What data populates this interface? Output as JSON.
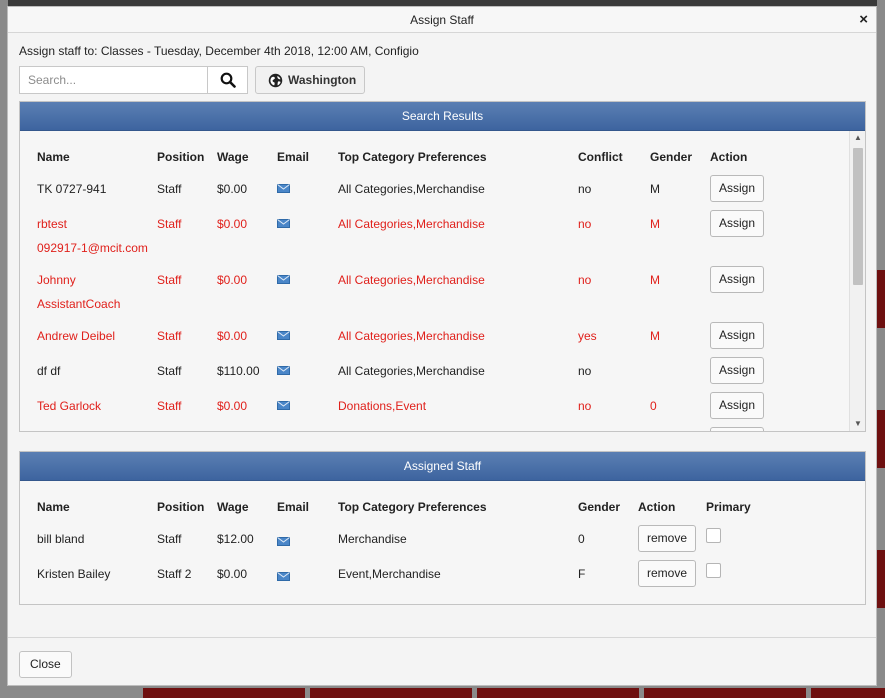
{
  "dialog": {
    "title": "Assign Staff",
    "close_symbol": "×",
    "assign_to": "Assign staff to: Classes - Tuesday, December 4th 2018, 12:00 AM, Configio"
  },
  "search": {
    "placeholder": "Search...",
    "location_label": "Washington"
  },
  "search_results": {
    "title": "Search Results",
    "headers": [
      "Name",
      "Position",
      "Wage",
      "Email",
      "Top Category Preferences",
      "Conflict",
      "Gender",
      "Action"
    ],
    "rows": [
      {
        "name": "TK 0727-941",
        "position": "Staff",
        "wage": "$0.00",
        "prefs": "All Categories,Merchandise",
        "conflict": "no",
        "gender": "M",
        "action": "Assign",
        "highlight": false
      },
      {
        "name": "rbtest",
        "position": "Staff",
        "wage": "$0.00",
        "prefs": "All Categories,Merchandise",
        "conflict": "no",
        "gender": "M",
        "action": "Assign",
        "highlight": true,
        "sub": "092917-1@mcit.com"
      },
      {
        "name": "Johnny",
        "position": "Staff",
        "wage": "$0.00",
        "prefs": "All Categories,Merchandise",
        "conflict": "no",
        "gender": "M",
        "action": "Assign",
        "highlight": true,
        "sub": "AssistantCoach"
      },
      {
        "name": "Andrew Deibel",
        "position": "Staff",
        "wage": "$0.00",
        "prefs": "All Categories,Merchandise",
        "conflict": "yes",
        "gender": "M",
        "action": "Assign",
        "highlight": true
      },
      {
        "name": "df df",
        "position": "Staff",
        "wage": "$110.00",
        "prefs": "All Categories,Merchandise",
        "conflict": "no",
        "gender": "",
        "action": "Assign",
        "highlight": false
      },
      {
        "name": "Ted Garlock",
        "position": "Staff",
        "wage": "$0.00",
        "prefs": "Donations,Event",
        "conflict": "no",
        "gender": "0",
        "action": "Assign",
        "highlight": true
      }
    ]
  },
  "assigned_staff": {
    "title": "Assigned Staff",
    "headers": [
      "Name",
      "Position",
      "Wage",
      "Email",
      "Top Category Preferences",
      "Gender",
      "Action",
      "Primary"
    ],
    "rows": [
      {
        "name": "bill bland",
        "position": "Staff",
        "wage": "$12.00",
        "prefs": "Merchandise",
        "gender": "0",
        "action": "remove"
      },
      {
        "name": "Kristen Bailey",
        "position": "Staff 2",
        "wage": "$0.00",
        "prefs": "Event,Merchandise",
        "gender": "F",
        "action": "remove"
      }
    ]
  },
  "footer": {
    "close_label": "Close"
  },
  "colors": {
    "header_blue": "#4a70a8",
    "highlight_red": "#e0201b",
    "email_icon_blue": "#4a86c8"
  }
}
